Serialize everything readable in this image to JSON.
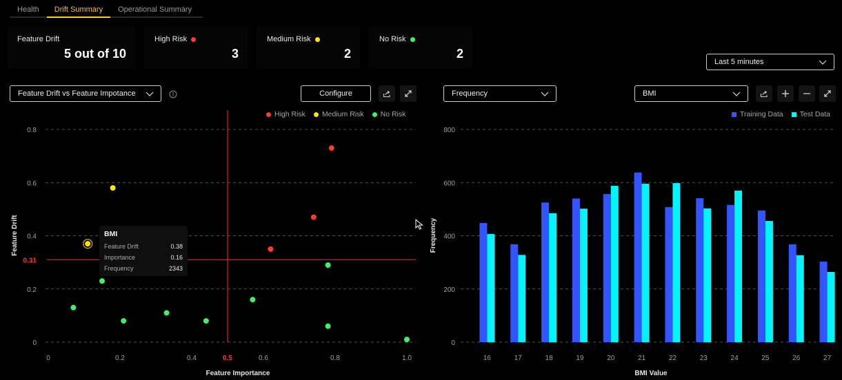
{
  "tabs": [
    {
      "label": "Health",
      "active": false
    },
    {
      "label": "Drift Summary",
      "active": true
    },
    {
      "label": "Operational Summary",
      "active": false
    }
  ],
  "cards": [
    {
      "label": "Feature Drift",
      "value": "5 out of 10",
      "dot": null
    },
    {
      "label": "High Risk",
      "value": "3",
      "dot": "#ff3b30"
    },
    {
      "label": "Medium Risk",
      "value": "2",
      "dot": "#ffe600"
    },
    {
      "label": "No Risk",
      "value": "2",
      "dot": "#3ef06a"
    }
  ],
  "time_range": {
    "selected": "Last 5 minutes"
  },
  "left_panel": {
    "chart_select": "Feature Drift vs Feature Impotance",
    "configure_label": "Configure",
    "icons": [
      "share-icon",
      "expand-icon"
    ],
    "legend": [
      {
        "label": "High Risk",
        "color": "#ff3b30"
      },
      {
        "label": "Medium Risk",
        "color": "#ffe600"
      },
      {
        "label": "No Risk",
        "color": "#3ef06a"
      }
    ],
    "tooltip": {
      "title": "BMI",
      "rows": [
        {
          "label": "Feature Drift",
          "value": "0.38"
        },
        {
          "label": "Importance",
          "value": "0.16"
        },
        {
          "label": "Frequency",
          "value": "2343"
        }
      ]
    }
  },
  "right_panel": {
    "metric_select": "Frequency",
    "feature_select": "BMI",
    "icons": [
      "share-icon",
      "zoom-in-icon",
      "zoom-out-icon",
      "expand-icon"
    ],
    "legend": [
      {
        "label": "Training Data",
        "color": "#3355ff"
      },
      {
        "label": "Test Data",
        "color": "#00f5ff"
      }
    ]
  },
  "chart_data": [
    {
      "type": "scatter",
      "title": "Feature Drift vs Feature Impotance",
      "xlabel": "Feature Importance",
      "ylabel": "Feature Drift",
      "xlim": [
        0,
        1.0
      ],
      "ylim": [
        0,
        0.8
      ],
      "xticks": [
        "0",
        "0.2",
        "0.4",
        "0.6",
        "0.8",
        "1.0"
      ],
      "xtick_values": [
        0,
        0.2,
        0.4,
        0.6,
        0.8,
        1.0
      ],
      "yticks": [
        "0",
        "0.2",
        "0.4",
        "0.6",
        "0.8"
      ],
      "ytick_values": [
        0,
        0.2,
        0.4,
        0.6,
        0.8
      ],
      "grid": true,
      "legend_position": "top-right",
      "threshold_x": {
        "value": 0.5,
        "label": "0.5",
        "color": "#e02020"
      },
      "threshold_y": {
        "value": 0.31,
        "label": "0.31",
        "color": "#e02020"
      },
      "series": [
        {
          "name": "High Risk",
          "color": "#ff3b30",
          "points": [
            [
              0.79,
              0.73
            ],
            [
              0.74,
              0.47
            ],
            [
              0.62,
              0.35
            ]
          ]
        },
        {
          "name": "Medium Risk",
          "color": "#ffe600",
          "points": [
            [
              0.18,
              0.58
            ],
            [
              0.37,
              0.41
            ],
            [
              0.11,
              0.37
            ]
          ]
        },
        {
          "name": "No Risk",
          "color": "#3ef06a",
          "points": [
            [
              0.15,
              0.23
            ],
            [
              0.07,
              0.13
            ],
            [
              0.21,
              0.08
            ],
            [
              0.33,
              0.11
            ],
            [
              0.44,
              0.08
            ],
            [
              0.57,
              0.16
            ],
            [
              0.78,
              0.29
            ],
            [
              0.78,
              0.06
            ],
            [
              1.0,
              0.01
            ]
          ]
        }
      ],
      "highlighted_point": {
        "series": "Medium Risk",
        "index": 2,
        "name": "BMI"
      }
    },
    {
      "type": "bar",
      "xlabel": "BMI Value",
      "ylabel": "Frequency",
      "ylim": [
        0,
        800
      ],
      "yticks": [
        "0",
        "200",
        "400",
        "600",
        "800"
      ],
      "ytick_values": [
        0,
        200,
        400,
        600,
        800
      ],
      "grid": true,
      "legend_position": "top-right",
      "categories": [
        "16",
        "17",
        "18",
        "19",
        "20",
        "21",
        "22",
        "23",
        "24",
        "25",
        "26",
        "27"
      ],
      "series": [
        {
          "name": "Training Data",
          "color": "#3355ff",
          "values": [
            448,
            368,
            525,
            540,
            557,
            638,
            508,
            541,
            516,
            495,
            368,
            303
          ]
        },
        {
          "name": "Test Data",
          "color": "#00f5ff",
          "values": [
            407,
            328,
            485,
            502,
            588,
            596,
            598,
            503,
            570,
            456,
            327,
            264
          ]
        }
      ]
    }
  ]
}
